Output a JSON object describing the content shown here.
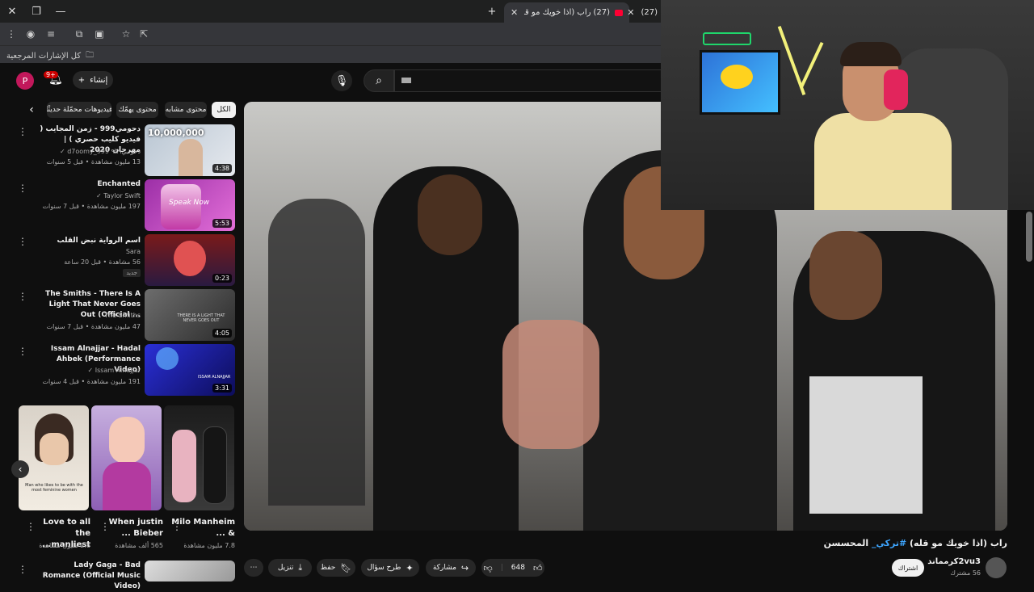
{
  "browser": {
    "tabs": [
      {
        "title": "راب (اذا خويك مو قله) #تركي...",
        "prefix": "(27)",
        "active": true
      },
      {
        "title": "(27)",
        "active": false
      }
    ],
    "new_tab_icon": "plus-icon",
    "bookmarks_label": "كل الإشارات المرجعية"
  },
  "youtube": {
    "avatar_letter": "P",
    "notif_count": "9+",
    "create_label": "إنشاء",
    "search_value": ""
  },
  "chips": [
    {
      "label": "الكل",
      "active": true
    },
    {
      "label": "محتوى مشابه",
      "active": false
    },
    {
      "label": "محتوى يهمّك",
      "active": false
    },
    {
      "label": "فيديوهات محمّلة حديثًا",
      "active": false
    }
  ],
  "recommendations": [
    {
      "title": "دحومي999 - زمن المجايب ( فيديو كليب حصري ) | مهرجان 2020",
      "channel": "دحومي٩٩٩ d7oomy_999 ✓",
      "meta": "13 مليون مشاهدة • قبل 5 سنوات",
      "duration": "4:38",
      "thumb_text": "10,000,000"
    },
    {
      "title": "Enchanted",
      "channel": "Taylor Swift ✓",
      "meta": "197 مليون مشاهدة • قبل 7 سنوات",
      "duration": "5:53",
      "thumb_text": "Speak Now"
    },
    {
      "title": "اسم الرواية نبض القلب",
      "channel": "Sara",
      "meta": "56 مشاهدة • قبل 20 ساعة",
      "badge": "جديد",
      "duration": "0:23"
    },
    {
      "title": "The Smiths - There Is A Light That Never Goes Out (Official ...",
      "channel": "The Smiths",
      "meta": "47 مليون مشاهدة • قبل 7 سنوات",
      "duration": "4:05",
      "thumb_text": "THERE IS A LIGHT THAT NEVER GOES OUT"
    },
    {
      "title": "Issam Alnajjar - Hadal Ahbek (Performance Video)",
      "channel": "Issam Alnajjar ✓",
      "meta": "191 مليون مشاهدة • قبل 4 سنوات",
      "duration": "3:31",
      "thumb_text": "ISSAM ALNAJJAR"
    }
  ],
  "shorts": [
    {
      "title": "Love to all the manliest...",
      "views": "2.8 مليون مشاهدة",
      "overlay": "Man who likes to be with the most feminine women"
    },
    {
      "title": "When justin Bieber ...",
      "views": "565 ألف مشاهدة"
    },
    {
      "title": "Milo Manheim & ...",
      "views": "7.8 مليون مشاهدة"
    }
  ],
  "last_rec": {
    "title": "Lady Gaga - Bad Romance (Official Music Video)"
  },
  "video": {
    "title_main": "راب (اذا خويك مو قله)",
    "hashtag": "#تركي_",
    "title_end": "المحسسن",
    "channel": "2vu3كرمماند",
    "subs": "56 مشترك",
    "subscribe_label": "اشتراك",
    "likes": "648",
    "share_label": "مشاركة",
    "ask_label": "طرح سؤال",
    "save_label": "حفظ",
    "download_label": "تنزيل"
  },
  "colors": {
    "accent": "#3ea6ff",
    "brand": "#ff0033",
    "bg": "#0f0f0f"
  }
}
